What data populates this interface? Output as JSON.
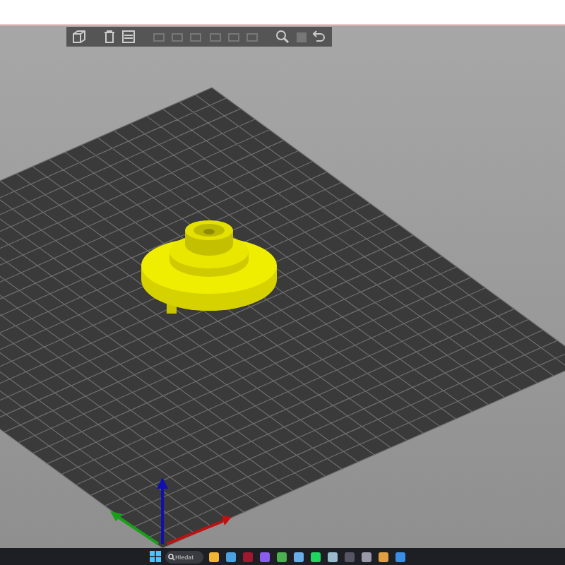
{
  "toolbar": {
    "buttons": [
      {
        "kind": "add",
        "disabled": false
      },
      {
        "kind": "delete",
        "disabled": false
      },
      {
        "kind": "delete_all",
        "disabled": false
      },
      {
        "kind": "arrange",
        "disabled": true
      },
      {
        "kind": "copy",
        "disabled": true
      },
      {
        "kind": "paste",
        "disabled": true
      },
      {
        "kind": "add_instance",
        "disabled": true
      },
      {
        "kind": "remove_instance",
        "disabled": true
      },
      {
        "kind": "split",
        "disabled": true
      },
      {
        "kind": "zoom",
        "disabled": false
      },
      {
        "kind": "layers",
        "disabled": true
      },
      {
        "kind": "undo",
        "disabled": false
      }
    ]
  },
  "taskbar": {
    "search": {
      "placeholder": "Hledat"
    }
  }
}
